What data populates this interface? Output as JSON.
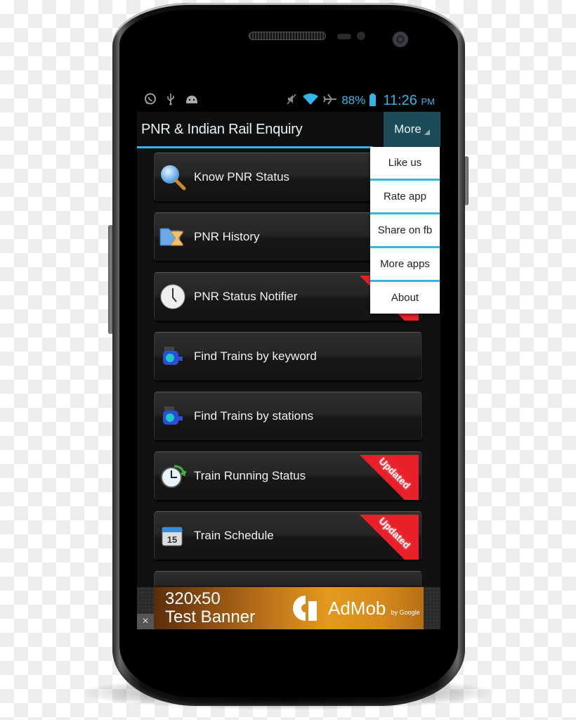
{
  "status_bar": {
    "left_icons": [
      "whatsapp-icon",
      "usb-icon",
      "android-icon"
    ],
    "right_icons": [
      "mute-icon",
      "wifi-icon",
      "airplane-icon"
    ],
    "battery_percent": "88%",
    "time": "11:26",
    "ampm": "PM"
  },
  "action_bar": {
    "title": "PNR & Indian Rail Enquiry",
    "more_label": "More"
  },
  "overflow_menu": {
    "items": [
      {
        "label": "Like us"
      },
      {
        "label": "Rate app"
      },
      {
        "label": "Share on fb"
      },
      {
        "label": "More apps"
      },
      {
        "label": "About"
      }
    ]
  },
  "main_list": {
    "items": [
      {
        "label": "Know PNR Status",
        "icon": "magnifier-icon",
        "badge": ""
      },
      {
        "label": "PNR History",
        "icon": "folder-hourglass-icon",
        "badge": ""
      },
      {
        "label": "PNR Status Notifier",
        "icon": "clock-icon",
        "badge": "Updated"
      },
      {
        "label": "Find Trains by keyword",
        "icon": "train-engine-icon",
        "badge": ""
      },
      {
        "label": "Find Trains by stations",
        "icon": "train-engine-icon",
        "badge": ""
      },
      {
        "label": "Train Running Status",
        "icon": "clock-refresh-icon",
        "badge": "Updated"
      },
      {
        "label": "Train Schedule",
        "icon": "calendar-icon",
        "badge": "Updated"
      }
    ],
    "updated_badge": "Updated"
  },
  "ad_banner": {
    "size_text_line1": "320x50",
    "size_text_line2": "Test Banner",
    "brand": "AdMob",
    "brand_sub": "by Google",
    "close_glyph": "×"
  }
}
